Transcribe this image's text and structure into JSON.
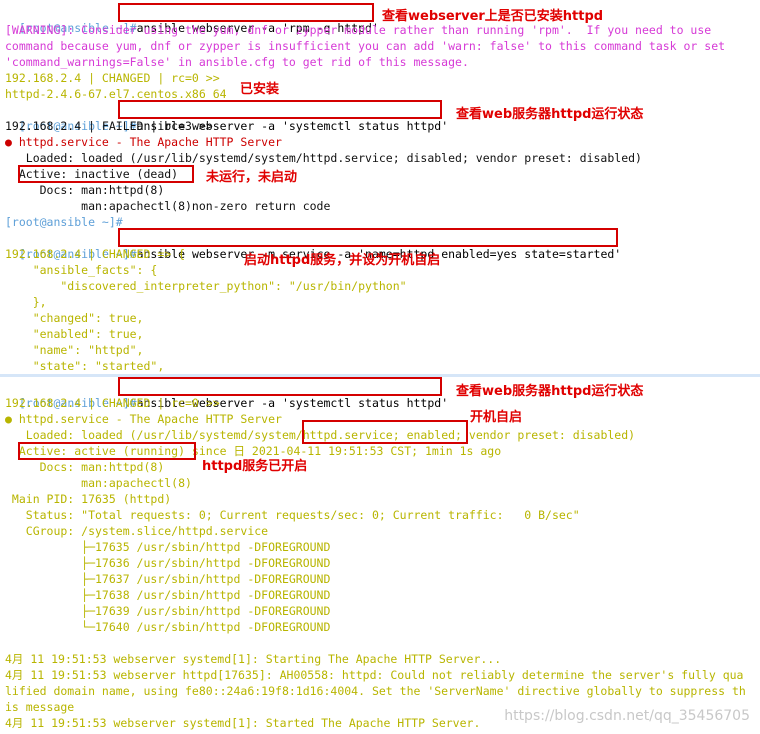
{
  "section1": {
    "prompt": "[root@ansible ~]#",
    "command": "ansible webserver -a 'rpm -q httpd'",
    "annotation": "查看webserver上是否已安装httpd",
    "warning_lines": [
      "[WARNING]: Consider using the yum, dnf or zypper module rather than running 'rpm'.  If you need to use",
      "command because yum, dnf or zypper is insufficient you can add 'warn: false' to this command task or set",
      "'command_warnings=False' in ansible.cfg to get rid of this message."
    ],
    "result_header": "192.168.2.4 | CHANGED | rc=0 >>",
    "result_value": "httpd-2.4.6-67.el7.centos.x86_64",
    "installed_annotation": "已安装"
  },
  "section2": {
    "prompt": "[root@ansible ~]#",
    "command": "ansible webserver -a 'systemctl status httpd'",
    "annotation": "查看web服务器httpd运行状态",
    "result_header": "192.168.2.4 | FAILED | rc=3 >>",
    "service_line": "● httpd.service - The Apache HTTP Server",
    "loaded_line": "   Loaded: loaded (/usr/lib/systemd/system/httpd.service; disabled; vendor preset: disabled)",
    "active_line": "  Active: inactive (dead)",
    "active_annotation": "未运行，未启动",
    "docs_line": "     Docs: man:httpd(8)",
    "docs_line2": "           man:apachectl(8)non-zero return code",
    "prompt_empty": "[root@ansible ~]#"
  },
  "section3": {
    "prompt": "[root@ansible ~]#",
    "command": "ansible webserver -m service -a 'name=httpd enabled=yes state=started'",
    "annotation": "启动httpd服务，并设为开机自启",
    "result_header": "192.168.2.4 | CHANGED => {",
    "json_lines": [
      "    \"ansible_facts\": {",
      "        \"discovered_interpreter_python\": \"/usr/bin/python\"",
      "    },",
      "    \"changed\": true,",
      "    \"enabled\": true,",
      "    \"name\": \"httpd\",",
      "    \"state\": \"started\","
    ]
  },
  "section4": {
    "prompt": "[root@ansible ~]#",
    "command": "ansible webserver -a 'systemctl status httpd'",
    "annotation": "查看web服务器httpd运行状态",
    "result_header": "192.168.2.4 | CHANGED | rc=0 >>",
    "service_line": "● httpd.service - The Apache HTTP Server",
    "enabled_annotation": "开机自启",
    "loaded_pre": "   Loaded: loaded (/usr/lib/systemd/system/",
    "loaded_boxed": "httpd.service; enabled;",
    "loaded_post": " vendor preset: disabled)",
    "active_boxed": "  Active: active (running)",
    "active_rest": " since 日 2021-04-11 19:51:53 CST; 1min 1s ago",
    "running_annotation": "httpd服务已开启",
    "docs_line": "     Docs: man:httpd(8)",
    "docs_line2": "           man:apachectl(8)",
    "mainpid_line": " Main PID: 17635 (httpd)",
    "status_line": "   Status: \"Total requests: 0; Current requests/sec: 0; Current traffic:   0 B/sec\"",
    "cgroup_line": "   CGroup: /system.slice/httpd.service",
    "processes": [
      "           ├─17635 /usr/sbin/httpd -DFOREGROUND",
      "           ├─17636 /usr/sbin/httpd -DFOREGROUND",
      "           ├─17637 /usr/sbin/httpd -DFOREGROUND",
      "           ├─17638 /usr/sbin/httpd -DFOREGROUND",
      "           ├─17639 /usr/sbin/httpd -DFOREGROUND",
      "           └─17640 /usr/sbin/httpd -DFOREGROUND"
    ],
    "log_lines": [
      "4月 11 19:51:53 webserver systemd[1]: Starting The Apache HTTP Server...",
      "4月 11 19:51:53 webserver httpd[17635]: AH00558: httpd: Could not reliably determine the server's fully qua",
      "lified domain name, using fe80::24a6:19f8:1d16:4004. Set the 'ServerName' directive globally to suppress th",
      "is message",
      "4月 11 19:51:53 webserver systemd[1]: Started The Apache HTTP Server."
    ]
  },
  "watermark": "https://blog.csdn.net/qq_35456705"
}
